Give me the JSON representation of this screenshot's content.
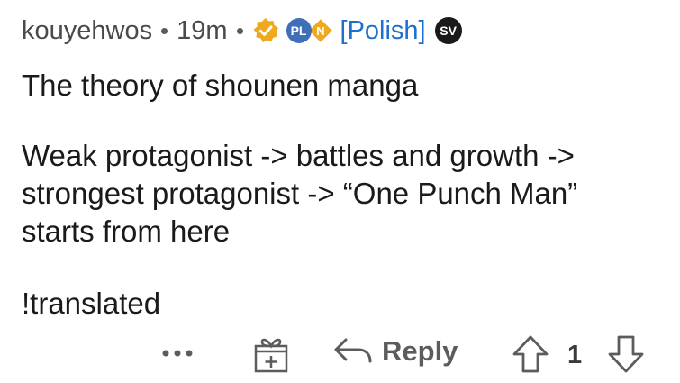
{
  "comment": {
    "author": "kouyehwos",
    "age": "19m",
    "flair": {
      "badge_left": "PL",
      "badge_right_icon": "n-diamond-icon",
      "text": "[Polish]",
      "sv_badge": "SV"
    },
    "title_line": "The theory of shounen manga",
    "body": "Weak protagonist -> battles and growth -> strongest protagonist -> “One Punch Man” starts from here",
    "footer_line": "!translated"
  },
  "actions": {
    "reply_label": "Reply",
    "vote_count": "1"
  },
  "colors": {
    "text": "#1a1a1b",
    "meta": "#4a4a4a",
    "flair_link": "#1d6fd1",
    "verified": "#f0a81c",
    "pl_badge": "#3f6fb6",
    "n_badge": "#f0a81c"
  }
}
